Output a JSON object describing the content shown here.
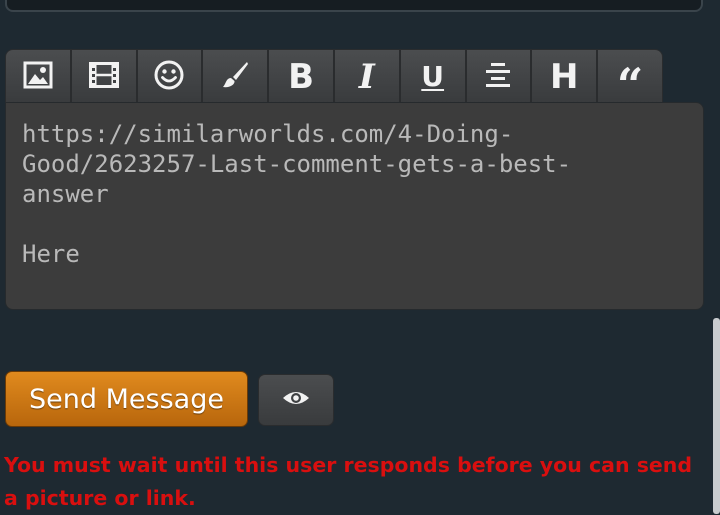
{
  "toolbar": {
    "buttons": [
      {
        "name": "insert-image",
        "icon": "image-icon"
      },
      {
        "name": "insert-video",
        "icon": "film-icon"
      },
      {
        "name": "insert-emoji",
        "icon": "smiley-icon"
      },
      {
        "name": "paint-brush",
        "icon": "brush-icon"
      },
      {
        "name": "bold",
        "icon": "bold-icon",
        "glyph": "B"
      },
      {
        "name": "italic",
        "icon": "italic-icon",
        "glyph": "I"
      },
      {
        "name": "underline",
        "icon": "underline-icon",
        "glyph": "U"
      },
      {
        "name": "align-center",
        "icon": "align-center-icon"
      },
      {
        "name": "heading",
        "icon": "heading-icon",
        "glyph": "H"
      },
      {
        "name": "quote",
        "icon": "quote-icon",
        "glyph": "“"
      }
    ]
  },
  "editor": {
    "value": "https://similarworlds.com/4-Doing-\nGood/2623257-Last-comment-gets-a-best-\nanswer\n\nHere"
  },
  "actions": {
    "send_label": "Send Message",
    "preview_icon": "eye-icon"
  },
  "warning": {
    "text": "You must wait until this user responds before you can send a picture or link."
  },
  "colors": {
    "background": "#1e2931",
    "send_button": "#d27a14",
    "warning_text": "#d90f0f",
    "editor_bg": "#3c3c3c"
  }
}
